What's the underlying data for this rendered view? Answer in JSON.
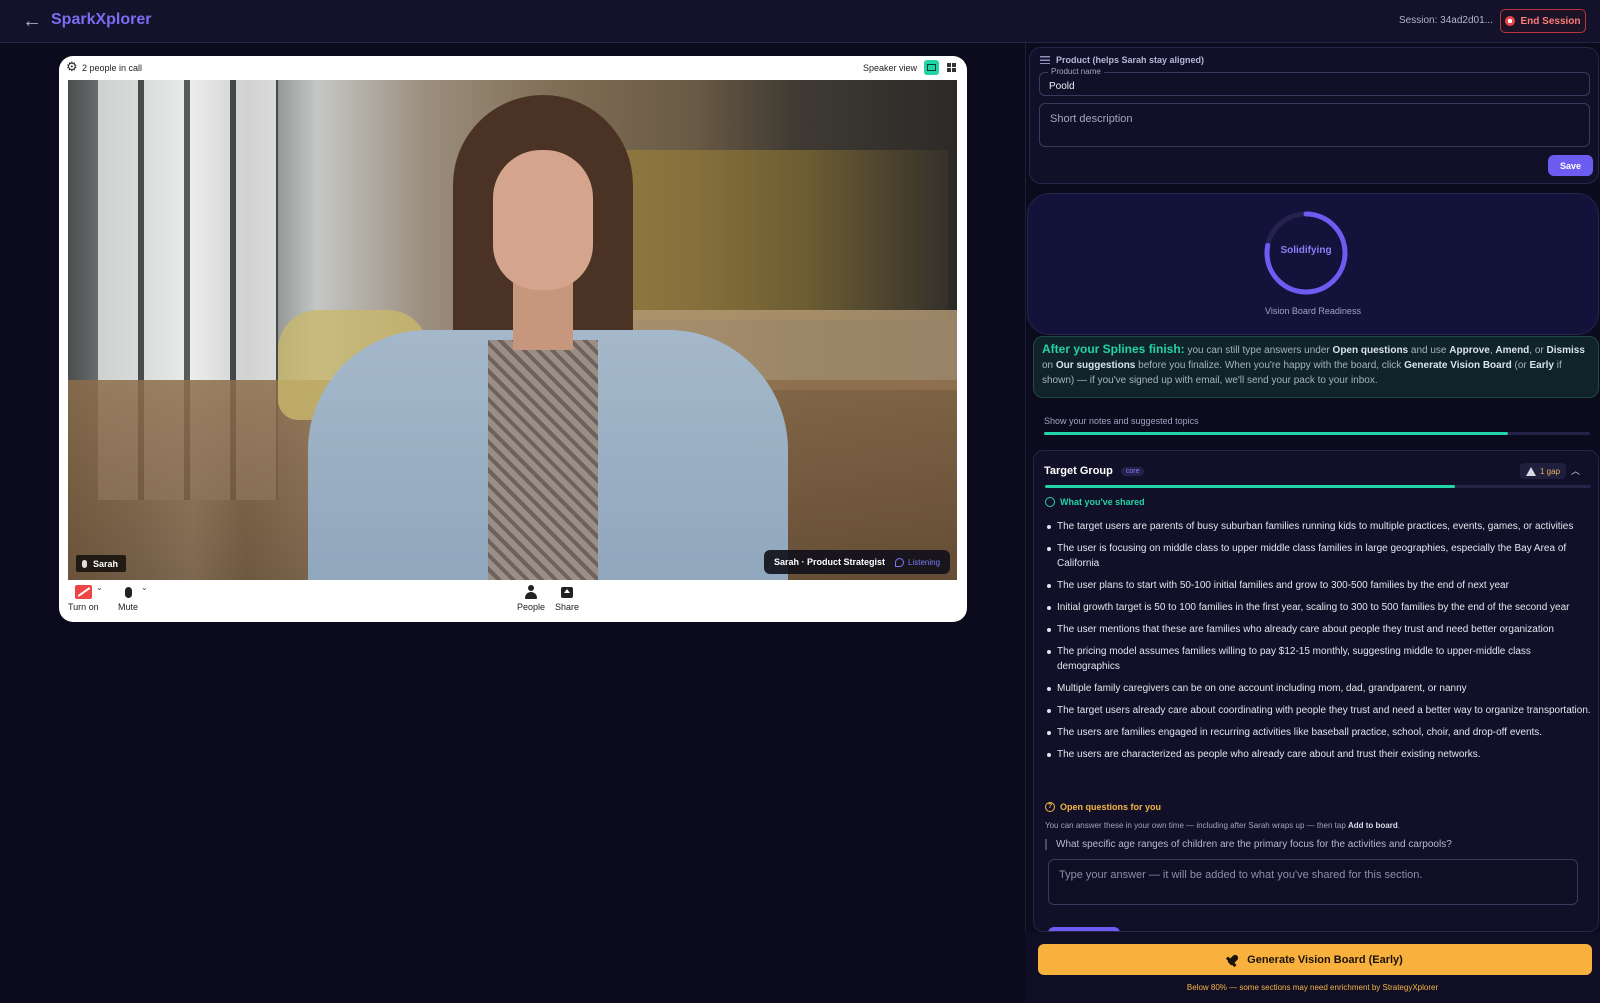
{
  "header": {
    "brand": "SparkXplorer",
    "session": "Session: 34ad2d01...",
    "end_label": "End Session"
  },
  "call": {
    "people_count": "2 people in call",
    "view_label": "Speaker view",
    "participant_name": "Sarah",
    "ai_label": "Sarah · Product Strategist",
    "ai_status": "Listening",
    "controls": {
      "camera": "Turn on",
      "mic": "Mute",
      "people": "People",
      "share": "Share"
    }
  },
  "product": {
    "title": "Product (helps Sarah stay aligned)",
    "name_label": "Product name",
    "name_value": "Poold",
    "description_placeholder": "Short description",
    "save_label": "Save"
  },
  "readiness": {
    "status": "Solidifying",
    "label": "Vision Board Readiness",
    "progress": 0.78,
    "ring_color": "#6d5cf2"
  },
  "info": {
    "lead": "After your Splines finish:",
    "t1": " you can still type answers under ",
    "b1": "Open questions",
    "t2": " and use ",
    "b2": "Approve",
    "t3": ", ",
    "b3": "Amend",
    "t4": ", or ",
    "b4": "Dismiss",
    "t5": " on ",
    "b5": "Our suggestions",
    "t6": " before you finalize. When you're happy with the board, click ",
    "b6": "Generate Vision Board",
    "t7": " (or ",
    "b7": "Early",
    "t8": " if shown) — if you've signed up with email, we'll send your pack to your inbox."
  },
  "notes": {
    "label": "Show your notes and suggested topics",
    "progress": 0.85
  },
  "target_group": {
    "title": "Target Group",
    "tag": "core",
    "gap_label": "1 gap",
    "progress": 0.75,
    "shared_heading": "What you've shared",
    "shared_items": [
      "The target users are parents of busy suburban families running kids to multiple practices, events, games, or activities",
      "The user is focusing on middle class to upper middle class families in large geographies, especially the Bay Area of California",
      "The user plans to start with 50-100 initial families and grow to 300-500 families by the end of next year",
      "Initial growth target is 50 to 100 families in the first year, scaling to 300 to 500 families by the end of the second year",
      "The user mentions that these are families who already care about people they trust and need better organization",
      "The pricing model assumes families willing to pay $12-15 monthly, suggesting middle to upper-middle class demographics",
      "Multiple family caregivers can be on one account including mom, dad, grandparent, or nanny",
      "The target users already care about coordinating with people they trust and need a better way to organize transportation.",
      "The users are families engaged in recurring activities like baseball practice, school, choir, and drop-off events.",
      "The users are characterized as people who already care about and trust their existing networks."
    ],
    "open_heading": "Open questions for you",
    "open_note_pre": "You can answer these in your own time — including after Sarah wraps up — then tap ",
    "open_note_bold": "Add to board",
    "open_note_post": ".",
    "question": "What specific age ranges of children are the primary focus for the activities and carpools?",
    "answer_placeholder": "Type your answer — it will be added to what you've shared for this section."
  },
  "footer": {
    "generate_label": "Generate Vision Board (Early)",
    "note": "Below 80% — some sections may need enrichment by StrategyXplorer"
  },
  "colors": {
    "accent": "#6d5cf2",
    "progress": "#22d3a6",
    "warning": "#f8b13d",
    "danger": "#ef4444"
  }
}
